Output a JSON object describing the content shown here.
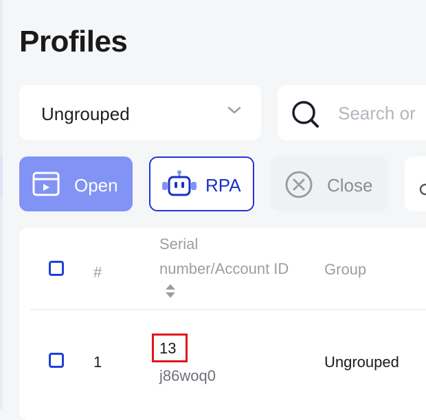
{
  "page": {
    "title": "Profiles"
  },
  "filters": {
    "group_select": {
      "value": "Ungrouped"
    },
    "search": {
      "placeholder": "Search or"
    }
  },
  "toolbar": {
    "open_label": "Open",
    "rpa_label": "RPA",
    "close_label": "Close"
  },
  "table": {
    "headers": {
      "index": "#",
      "serial": "Serial number/Account ID",
      "group": "Group"
    },
    "rows": [
      {
        "index": "1",
        "serial": "13",
        "account_id": "j86woq0",
        "group": "Ungrouped"
      }
    ]
  },
  "colors": {
    "accent": "#8193f5",
    "primary_border": "#2034d6",
    "highlight_box": "#e0151b"
  }
}
